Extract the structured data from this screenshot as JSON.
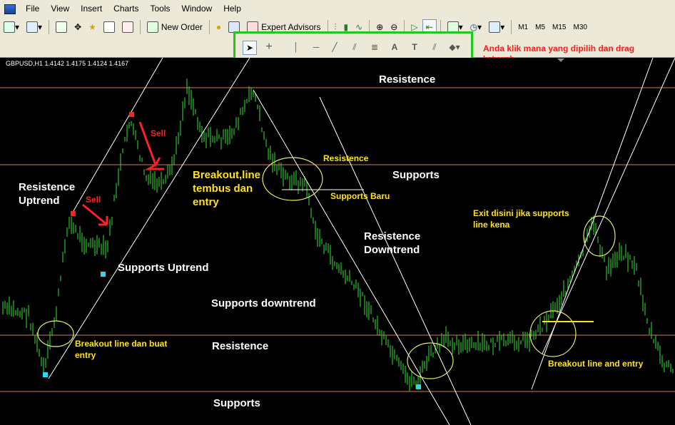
{
  "menu": [
    "File",
    "View",
    "Insert",
    "Charts",
    "Tools",
    "Window",
    "Help"
  ],
  "toolbar": {
    "new_order": "New Order",
    "expert_advisors": "Expert Advisors",
    "timeframes": [
      "M1",
      "M5",
      "M15",
      "M30"
    ]
  },
  "draw_tools": [
    "cursor",
    "crosshair",
    "vertical-line",
    "horizontal-line",
    "trendline",
    "channel",
    "fibonacci",
    "text",
    "text-label",
    "parallel",
    "shapes"
  ],
  "symbol_line": "GBPUSD,H1  1.4142 1.4175 1.4124 1.4167",
  "hint": {
    "line1": "Anda klik mana yang dipilih dan drag",
    "line2": "ketuwah"
  },
  "labels": {
    "resistence_top": "Resistence",
    "supports_mid": "Supports",
    "resistence_small": "Resistence",
    "supports_baru": "Supports Baru",
    "resistence_uptrend": "Resistence\nUptrend",
    "sell1": "Sell",
    "sell2": "Sell",
    "breakout_line": "Breakout,line\ntembus dan\nentry",
    "resistence_downtrend": "Resistence\nDowntrend",
    "supports_uptrend": "Supports Uptrend",
    "supports_downtrend": "Supports downtrend",
    "resistence_low": "Resistence",
    "supports_low": "Supports",
    "breakout_buat": "Breakout line dan buat\nentry",
    "exit_disini": "Exit disini jika supports\nline kena",
    "breakout_entry": "Breakout line and entry"
  },
  "colors": {
    "bars": "#32e832",
    "level": "#d2804a",
    "highlight": "#1ccc1c",
    "annot": "#ffe21a",
    "sell": "#ff2020"
  }
}
